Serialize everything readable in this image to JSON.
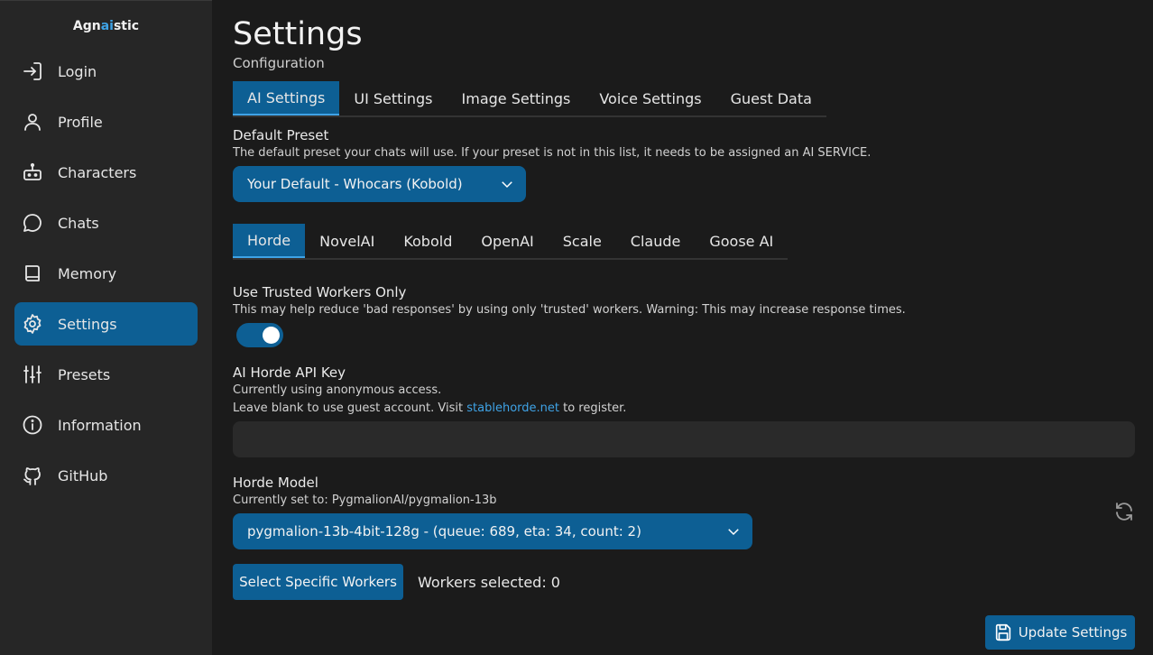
{
  "sidebar": {
    "brand_prefix": "Agn",
    "brand_accent": "ai",
    "brand_suffix": "stic",
    "items": [
      {
        "label": "Login",
        "icon": "login-icon"
      },
      {
        "label": "Profile",
        "icon": "user-icon"
      },
      {
        "label": "Characters",
        "icon": "bot-icon"
      },
      {
        "label": "Chats",
        "icon": "chat-bubble-icon"
      },
      {
        "label": "Memory",
        "icon": "book-icon"
      },
      {
        "label": "Settings",
        "icon": "gear-icon",
        "active": true
      },
      {
        "label": "Presets",
        "icon": "sliders-icon"
      },
      {
        "label": "Information",
        "icon": "info-icon"
      },
      {
        "label": "GitHub",
        "icon": "github-icon"
      }
    ]
  },
  "header": {
    "title": "Settings",
    "subtitle": "Configuration"
  },
  "settings_tabs": [
    "AI Settings",
    "UI Settings",
    "Image Settings",
    "Voice Settings",
    "Guest Data"
  ],
  "default_preset": {
    "label": "Default Preset",
    "help": "The default preset your chats will use. If your preset is not in this list, it needs to be assigned an AI SERVICE.",
    "value": "Your Default - Whocars (Kobold)"
  },
  "service_tabs": [
    "Horde",
    "NovelAI",
    "Kobold",
    "OpenAI",
    "Scale",
    "Claude",
    "Goose AI"
  ],
  "trusted_workers": {
    "label": "Use Trusted Workers Only",
    "help": "This may help reduce 'bad responses' by using only 'trusted' workers. Warning: This may increase response times.",
    "enabled": true
  },
  "api_key": {
    "label": "AI Horde API Key",
    "help_line1": "Currently using anonymous access.",
    "help_line2_prefix": "Leave blank to use guest account. Visit ",
    "help_link": "stablehorde.net",
    "help_line2_suffix": " to register.",
    "value": "",
    "placeholder": ""
  },
  "horde_model": {
    "label": "Horde Model",
    "help": "Currently set to: PygmalionAI/pygmalion-13b",
    "value": "pygmalion-13b-4bit-128g - (queue: 689, eta: 34, count: 2)"
  },
  "workers": {
    "button_label": "Select Specific Workers",
    "selected_text": "Workers selected: 0"
  },
  "update_button": "Update Settings",
  "colors": {
    "accent": "#0d5f94",
    "link": "#3fa3e6",
    "background": "#1b1b1b",
    "sidebar": "#262626"
  }
}
